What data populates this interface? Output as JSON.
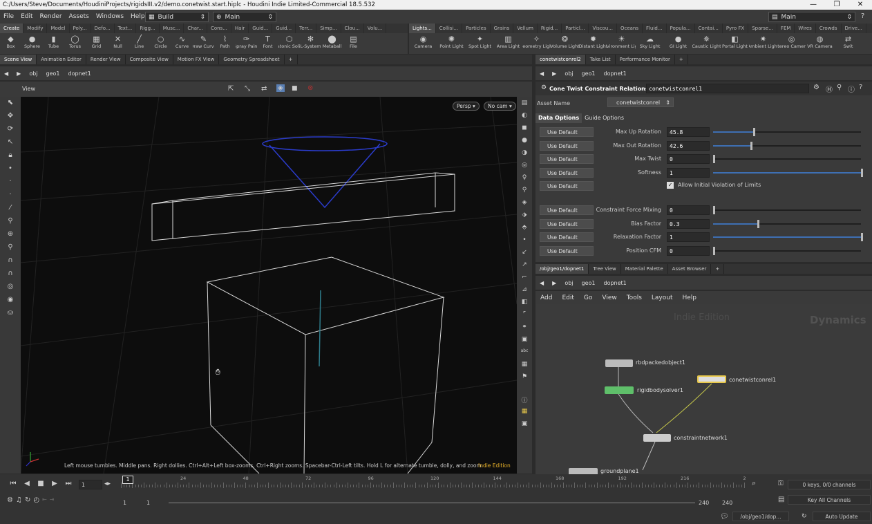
{
  "window": {
    "title": "C:/Users/Steve/Documents/HoudiniProjects/rigidsIII.v2/demo.conetwist.start.hiplc - Houdini Indie Limited-Commercial 18.5.532",
    "minimize": "—",
    "maximize": "❐",
    "close": "✕"
  },
  "menu": {
    "items": [
      "File",
      "Edit",
      "Render",
      "Assets",
      "Windows",
      "Help"
    ],
    "desktop": "Build",
    "context": "Main",
    "right_context": "Main"
  },
  "shelf_left": {
    "tabs": [
      "Create",
      "Modify",
      "Model",
      "Poly...",
      "Defo...",
      "Text...",
      "Rigg...",
      "Musc...",
      "Char...",
      "Cons...",
      "Hair",
      "Guid...",
      "Guid...",
      "Terr...",
      "Simp...",
      "Clou...",
      "Volu..."
    ],
    "tools": [
      {
        "label": "Box",
        "icon": "box-icon",
        "glyph": "◆"
      },
      {
        "label": "Sphere",
        "icon": "sphere-icon",
        "glyph": "●"
      },
      {
        "label": "Tube",
        "icon": "tube-icon",
        "glyph": "▮"
      },
      {
        "label": "Torus",
        "icon": "torus-icon",
        "glyph": "◯"
      },
      {
        "label": "Grid",
        "icon": "grid-icon",
        "glyph": "▦"
      },
      {
        "label": "Null",
        "icon": "null-icon",
        "glyph": "✕"
      },
      {
        "label": "Line",
        "icon": "line-icon",
        "glyph": "╱"
      },
      {
        "label": "Circle",
        "icon": "circle-icon",
        "glyph": "○"
      },
      {
        "label": "Curve",
        "icon": "curve-icon",
        "glyph": "∿"
      },
      {
        "label": "Draw Curve",
        "icon": "draw-curve-icon",
        "glyph": "✎"
      },
      {
        "label": "Path",
        "icon": "path-icon",
        "glyph": "⌇"
      },
      {
        "label": "Spray Paint",
        "icon": "spray-paint-icon",
        "glyph": "✑"
      },
      {
        "label": "Font",
        "icon": "font-icon",
        "glyph": "T"
      },
      {
        "label": "Platonic Solids",
        "icon": "platonic-icon",
        "glyph": "⬡"
      },
      {
        "label": "L-System",
        "icon": "lsystem-icon",
        "glyph": "✻"
      },
      {
        "label": "Metaball",
        "icon": "metaball-icon",
        "glyph": "⬤"
      },
      {
        "label": "File",
        "icon": "file-icon",
        "glyph": "▤"
      }
    ]
  },
  "shelf_right": {
    "tabs": [
      "Lights...",
      "Collisi...",
      "Particles",
      "Grains",
      "Vellum",
      "Rigid...",
      "Particl...",
      "Viscou...",
      "Oceans",
      "Fluid...",
      "Popula...",
      "Contai...",
      "Pyro FX",
      "Sparse...",
      "FEM",
      "Wires",
      "Crowds",
      "Drive..."
    ],
    "tools": [
      {
        "label": "Camera",
        "icon": "camera-icon",
        "glyph": "◉"
      },
      {
        "label": "Point Light",
        "icon": "point-light-icon",
        "glyph": "✺"
      },
      {
        "label": "Spot Light",
        "icon": "spot-light-icon",
        "glyph": "✦"
      },
      {
        "label": "Area Light",
        "icon": "area-light-icon",
        "glyph": "▥"
      },
      {
        "label": "Geometry Light",
        "icon": "geometry-light-icon",
        "glyph": "✧"
      },
      {
        "label": "Volume Light",
        "icon": "volume-light-icon",
        "glyph": "❂"
      },
      {
        "label": "Distant Light",
        "icon": "distant-light-icon",
        "glyph": "✹"
      },
      {
        "label": "Environment Light",
        "icon": "environment-light-icon",
        "glyph": "☀"
      },
      {
        "label": "Sky Light",
        "icon": "sky-light-icon",
        "glyph": "☁"
      },
      {
        "label": "GI Light",
        "icon": "gi-light-icon",
        "glyph": "●"
      },
      {
        "label": "Caustic Light",
        "icon": "caustic-light-icon",
        "glyph": "✵"
      },
      {
        "label": "Portal Light",
        "icon": "portal-light-icon",
        "glyph": "◧"
      },
      {
        "label": "Ambient Light",
        "icon": "ambient-light-icon",
        "glyph": "✷"
      },
      {
        "label": "Stereo Camera",
        "icon": "stereo-camera-icon",
        "glyph": "◎"
      },
      {
        "label": "VR Camera",
        "icon": "vr-camera-icon",
        "glyph": "◍"
      },
      {
        "label": "Swit",
        "icon": "switcher-icon",
        "glyph": "⇄"
      }
    ]
  },
  "left_panes": {
    "tabs": [
      "Scene View",
      "Animation Editor",
      "Render View",
      "Composite View",
      "Motion FX View",
      "Geometry Spreadsheet"
    ],
    "path": [
      "obj",
      "geo1",
      "dopnet1"
    ],
    "view_label": "View",
    "persp": "Persp",
    "cam": "No cam",
    "status_hint": "Left mouse tumbles. Middle pans. Right dollies. Ctrl+Alt+Left box-zooms. Ctrl+Right zooms. Spacebar-Ctrl-Left tilts. Hold L for alternate tumble, dolly, and zoom.",
    "edition": "Indie Edition"
  },
  "param_pane": {
    "tabs": [
      "conetwistconrel2",
      "Take List",
      "Performance Monitor"
    ],
    "path": [
      "obj",
      "geo1",
      "dopnet1"
    ],
    "node_type": "Cone Twist Constraint Relationship",
    "node_name": "conetwistconrel1",
    "asset_label": "Asset Name",
    "asset_value": "conetwistconrel",
    "subtabs": [
      "Data Options",
      "Guide Options"
    ],
    "use_default": "Use Default",
    "rows": [
      {
        "label": "Max Up Rotation",
        "value": "45.8",
        "level": 0.27
      },
      {
        "label": "Max Out Rotation",
        "value": "42.6",
        "level": 0.25
      },
      {
        "label": "Max Twist",
        "value": "0",
        "level": 0
      },
      {
        "label": "Softness",
        "value": "1",
        "level": 1
      }
    ],
    "checkbox_label": "Allow Initial Violation of Limits",
    "rows2": [
      {
        "label": "Constraint Force Mixing",
        "value": "0",
        "level": 0
      },
      {
        "label": "Bias Factor",
        "value": "0.3",
        "level": 0.3
      },
      {
        "label": "Relaxation Factor",
        "value": "1",
        "level": 1
      },
      {
        "label": "Position CFM",
        "value": "0",
        "level": 0
      }
    ]
  },
  "network_pane": {
    "tabs": [
      "/obj/geo1/dopnet1",
      "Tree View",
      "Material Palette",
      "Asset Browser"
    ],
    "path": [
      "obj",
      "geo1",
      "dopnet1"
    ],
    "menu": [
      "Add",
      "Edit",
      "Go",
      "View",
      "Tools",
      "Layout",
      "Help"
    ],
    "watermark": "Indie Edition",
    "context_label": "Dynamics",
    "nodes": {
      "rbd": "rbdpackedobject1",
      "solver": "rigidbodysolver1",
      "cone": "conetwistconrel1",
      "network": "constraintnetwork1",
      "ground": "groundplane1"
    }
  },
  "timeline": {
    "frame": "1",
    "ticks": [
      "24",
      "48",
      "72",
      "96",
      "120",
      "144",
      "168",
      "192",
      "216",
      "2"
    ],
    "current_marker": "1",
    "start": "1",
    "start2": "1",
    "end": "240",
    "end2": "240",
    "keys": "0 keys, 0/0 channels",
    "key_all": "Key All Channels",
    "status_path": "/obj/geo1/dop...",
    "auto_update": "Auto Update"
  },
  "colors": {
    "accent": "#3e6fb3",
    "selected_node": "#e8c84a",
    "solver_node": "#5fbf6a"
  }
}
